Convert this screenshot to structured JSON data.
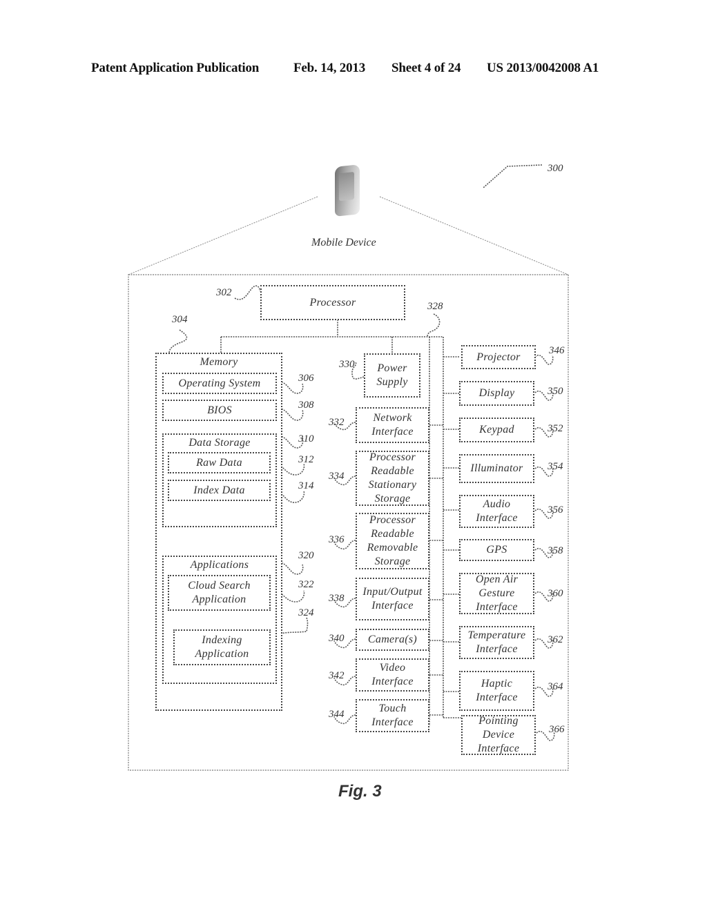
{
  "header": {
    "publication": "Patent Application Publication",
    "date": "Feb. 14, 2013",
    "sheet": "Sheet 4 of 24",
    "number": "US 2013/0042008 A1"
  },
  "figure": {
    "ref": "300",
    "device_label": "Mobile Device",
    "caption": "Fig. 3"
  },
  "processor": {
    "label": "Processor",
    "ref": "302"
  },
  "bus": {
    "ref": "328"
  },
  "memory": {
    "label": "Memory",
    "ref": "304",
    "os": {
      "label": "Operating System",
      "ref": "306"
    },
    "bios": {
      "label": "BIOS",
      "ref": "308"
    },
    "data_storage": {
      "label": "Data Storage",
      "ref": "310",
      "raw": {
        "label": "Raw Data",
        "ref": "312"
      },
      "index": {
        "label": "Index Data",
        "ref": "314"
      }
    },
    "applications": {
      "label": "Applications",
      "ref": "320",
      "cloud": {
        "label": "Cloud Search Application",
        "ref": "322"
      },
      "indexing": {
        "label": "Indexing Application",
        "ref": "324"
      }
    }
  },
  "middle": [
    {
      "label": "Power Supply",
      "ref": "330"
    },
    {
      "label": "Network Interface",
      "ref": "332"
    },
    {
      "label": "Processor Readable Stationary Storage",
      "ref": "334"
    },
    {
      "label": "Processor Readable Removable Storage",
      "ref": "336"
    },
    {
      "label": "Input/Output Interface",
      "ref": "338"
    },
    {
      "label": "Camera(s)",
      "ref": "340"
    },
    {
      "label": "Video Interface",
      "ref": "342"
    },
    {
      "label": "Touch Interface",
      "ref": "344"
    }
  ],
  "right": [
    {
      "label": "Projector",
      "ref": "346"
    },
    {
      "label": "Display",
      "ref": "350"
    },
    {
      "label": "Keypad",
      "ref": "352"
    },
    {
      "label": "Illuminator",
      "ref": "354"
    },
    {
      "label": "Audio Interface",
      "ref": "356"
    },
    {
      "label": "GPS",
      "ref": "358"
    },
    {
      "label": "Open Air Gesture Interface",
      "ref": "360"
    },
    {
      "label": "Temperature Interface",
      "ref": "362"
    },
    {
      "label": "Haptic Interface",
      "ref": "364"
    },
    {
      "label": "Pointing Device Interface",
      "ref": "366"
    }
  ]
}
